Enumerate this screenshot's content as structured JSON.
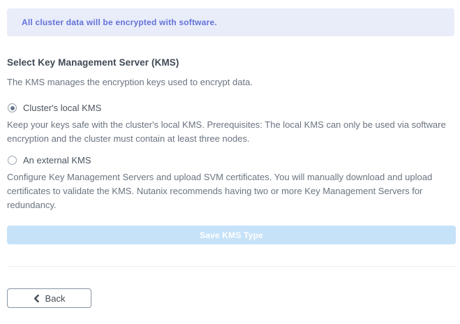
{
  "colors": {
    "banner_bg": "#e9edfa",
    "banner_text": "#6372d8",
    "heading_text": "#3f4954",
    "body_text": "#6a7480",
    "option_label_text": "#4a545e",
    "radio_dot": "#66788c",
    "save_button_bg": "#c6e2f8",
    "save_button_text": "#ffffff",
    "divider": "#eceef1",
    "back_button_border": "#8793a0",
    "back_button_text": "#434c55"
  },
  "banner": {
    "message": "All cluster data will be encrypted with software."
  },
  "kms_section": {
    "title": "Select Key Management Server (KMS)",
    "subtitle": "The KMS manages the encryption keys used to encrypt data.",
    "options": [
      {
        "label": "Cluster's local KMS",
        "selected": true,
        "description": "Keep your keys safe with the cluster's local KMS. Prerequisites: The local KMS can only be used via software encryption and the cluster must contain at least three nodes."
      },
      {
        "label": "An external KMS",
        "selected": false,
        "description": "Configure Key Management Servers and upload SVM certificates. You will manually download and upload certificates to validate the KMS. Nutanix recommends having two or more Key Management Servers for redundancy."
      }
    ]
  },
  "actions": {
    "save_label": "Save KMS Type",
    "back_label": "Back",
    "back_icon": "chevron-left"
  }
}
